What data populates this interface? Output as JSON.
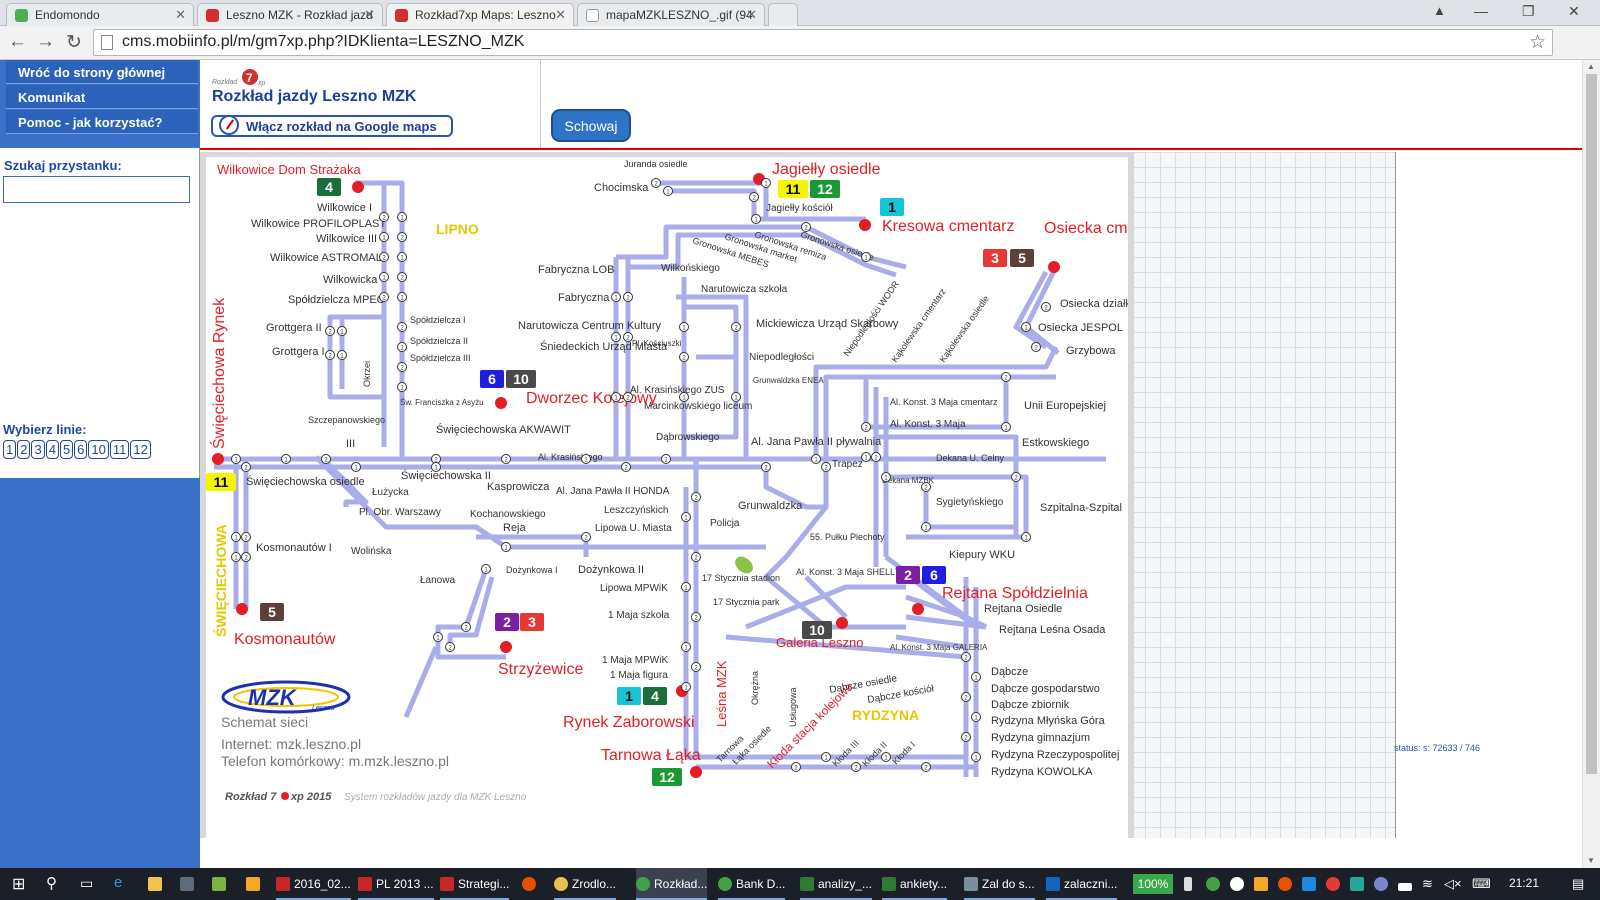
{
  "browser": {
    "tabs": [
      {
        "label": "Endomondo",
        "fav": "#4caf50"
      },
      {
        "label": "Leszno MZK - Rozkład jazd",
        "fav": "#d32f2f"
      },
      {
        "label": "Rozkład7xp Maps: Leszno",
        "fav": "#d32f2f"
      },
      {
        "label": "mapaMZKLESZNO_.gif (94",
        "fav": "#9e9e9e"
      }
    ],
    "url": "cms.mobiinfo.pl/m/gm7xp.php?IDKlienta=LESZNO_MZK"
  },
  "sidebar": {
    "links": [
      "Wróć do strony głównej",
      "Komunikat",
      "Pomoc - jak korzystać?"
    ],
    "search_label": "Szukaj przystanku:",
    "search_value": "",
    "lines_label": "Wybierz linie:",
    "lines": [
      "1",
      "2",
      "3",
      "4",
      "5",
      "6",
      "10",
      "11",
      "12"
    ]
  },
  "header": {
    "logo_text": "Rozkład7xp",
    "title": "Rozkład jazdy Leszno MZK",
    "gmaps_label": "Włącz rozkład na Google maps",
    "hide_button": "Schowaj"
  },
  "status_text": "status: s: 72633 / 746",
  "map": {
    "stops_red": [
      "Wilkowice Dom Strażaka",
      "Jagiełły osiedle",
      "Kresowa cmentarz",
      "Osiecka cmentarz",
      "Święciechowa Rynek",
      "Dworzec Kolejowy",
      "Rejtana Spółdzielnia",
      "Galeria Leszno",
      "Kosmonautów",
      "Strzyżewice",
      "Rynek Zaborowski",
      "Tarnowa Łąka",
      "Leśna MZK",
      "Kłoda stacja kolejowa"
    ],
    "districts": [
      "LIPNO",
      "ŚWIĘCIECHOWA",
      "RYDZYNA"
    ],
    "stops_left": [
      "Wilkowice I",
      "Wilkowice PROFILOPLAST",
      "Wilkowice III",
      "Wilkowice ASTROMAL",
      "Wilkowicka",
      "Spółdzielcza MPEC",
      "Grottgera II",
      "Grottgera I",
      "Spółdzielcza I",
      "Spółdzielcza II",
      "Spółdzielcza III",
      "Święciechowska AKWAWIT",
      "Święciechowska II",
      "Święciechowska osiedle",
      "Łużycka",
      "Pl. Obr. Warszawy",
      "Kosmonautów I",
      "Wolińska",
      "Łanowa",
      "Kasprowicza",
      "Kochanowskiego",
      "Reja",
      "Dożynkowa I",
      "Dożynkowa II",
      "Okrzei",
      "III",
      "Szczepanowskiego",
      "Św. Franciszka z Asyżu"
    ],
    "stops_center": [
      "Juranda osiedle",
      "Chocimska",
      "Jagiełły kościół",
      "Fabryczna LOB",
      "Fabryczna",
      "Wilkońskiego",
      "Narutowicza szkoła",
      "Narutowicza Centrum Kultury",
      "Pl. Kościuszki",
      "Śniedeckich Urząd Miasta",
      "Mickiewicza Urząd Skarbowy",
      "Niepodległości",
      "Al. Krasińskiego ZUS",
      "Marcinkowskiego liceum",
      "Dąbrowskiego",
      "Al. Krasińskiego",
      "Al. Jana Pawła II HONDA",
      "Leszczyńskich",
      "Lipowa U. Miasta",
      "Lipowa MPWiK",
      "1 Maja szkoła",
      "1 Maja MPWiK",
      "1 Maja figura",
      "Policja",
      "Grunwaldzka",
      "Grunwaldzka ENEA",
      "Al. Jana Pawła II pływalnia",
      "Trapez",
      "17 Stycznia stadion",
      "17 Stycznia park",
      "55. Pułku Piechoty",
      "Al. Konst. 3 Maja SHELL",
      "Okrężna",
      "Usługowa",
      "Tarnowa",
      "Łąka osiedle",
      "Kłoda III",
      "Kłoda II",
      "Kłoda I",
      "Gronowska MEBES",
      "Gronowska market",
      "Gronowska remiza",
      "Gronowska osiedle"
    ],
    "stops_right": [
      "Osiecka działki",
      "Osiecka JESPOL",
      "Grzybowa",
      "Niepodległości WODR",
      "Kąkolewska cmentarz",
      "Kąkolewska osiedle",
      "Unii Europejskiej",
      "Al. Konst. 3 Maja cmentarz",
      "Al. Konst. 3 Maja",
      "Estkowskiego",
      "Dekana U. Celny",
      "Dekana MZBK",
      "Sygietyńskiego",
      "Szpitalna-Szpital",
      "Kiepury WKU",
      "Rejtana Osiedle",
      "Rejtana Leśna Osada",
      "Al. Konst. 3 Maja GALERIA",
      "Dąbcze osiedle",
      "Dąbcze kościół",
      "Dąbcze",
      "Dąbcze gospodarstwo",
      "Dąbcze zbiornik",
      "Rydzyna Młyńska Góra",
      "Rydzyna gimnazjum",
      "Rydzyna Rzeczypospolitej",
      "Rydzyna KOWOLKA"
    ],
    "footer": {
      "logo": "MZK",
      "logo_sub": "Leszno",
      "scheme": "Schemat sieci",
      "internet": "Internet: mzk.leszno.pl",
      "mobile": "Telefon komórkowy: m.mzk.leszno.pl",
      "brand_a": "Rozkład 7",
      "brand_b": "xp 2015",
      "system": "System rozkładów jazdy dla MZK Leszno"
    },
    "badge_colors": {
      "1": "#17c3d6",
      "2": "#7b1fa2",
      "3": "#e53935",
      "4": "#1b6e3a",
      "5": "#5d4037",
      "6": "#1e1ee0",
      "10": "#4a4a4a",
      "11": "#f5f500",
      "12": "#1a9a34"
    },
    "route_color": "#a9aeea"
  },
  "taskbar": {
    "items": [
      "2016_02...",
      "PL 2013 ...",
      "Strategi...",
      "Zrodlo...",
      "Rozkład...",
      "Bank D...",
      "analizy_...",
      "ankiety...",
      "Zal do s...",
      "zalaczni..."
    ],
    "zoom": "100%",
    "clock": "21:21"
  }
}
